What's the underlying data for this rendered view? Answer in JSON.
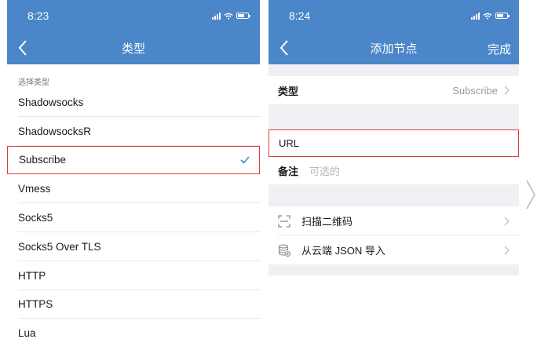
{
  "left": {
    "status_time": "8:23",
    "nav_title": "类型",
    "section_header": "选择类型",
    "items": [
      "Shadowsocks",
      "ShadowsocksR",
      "Subscribe",
      "Vmess",
      "Socks5",
      "Socks5 Over TLS",
      "HTTP",
      "HTTPS",
      "Lua"
    ],
    "selected_item": "Subscribe"
  },
  "right": {
    "status_time": "8:24",
    "nav_title": "添加节点",
    "done_label": "完成",
    "type_label": "类型",
    "type_value": "Subscribe",
    "url_label": "URL",
    "note_label": "备注",
    "note_placeholder": "可选的",
    "scan_label": "扫描二维码",
    "cloud_label": "从云端 JSON 导入"
  },
  "colors": {
    "nav_bg": "#4a86c8",
    "highlight_border": "#e03c3c",
    "check": "#4a86c8"
  },
  "icons": [
    "back-arrow-icon",
    "checkmark-icon",
    "chevron-right-icon",
    "qr-scan-icon",
    "cloud-database-icon",
    "signal-icon",
    "wifi-icon",
    "battery-icon"
  ]
}
